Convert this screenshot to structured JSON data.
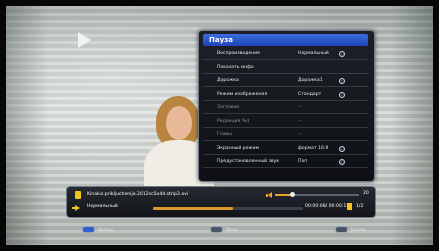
{
  "menu": {
    "title": "Пауза",
    "items": [
      {
        "label": "Воспроизведение",
        "value": "Нормальный",
        "has_option": true,
        "enabled": true
      },
      {
        "label": "Показать инфо",
        "value": "",
        "has_option": false,
        "enabled": true
      },
      {
        "label": "Дорожка",
        "value": "Дорожка1",
        "has_option": true,
        "enabled": true
      },
      {
        "label": "Режим изображения",
        "value": "Стандарт",
        "has_option": true,
        "enabled": true
      },
      {
        "label": "Заглавие",
        "value": "--",
        "has_option": false,
        "enabled": false
      },
      {
        "label": "Редакция %d",
        "value": "--",
        "has_option": false,
        "enabled": false
      },
      {
        "label": "Главы",
        "value": "--",
        "has_option": false,
        "enabled": false
      },
      {
        "label": "Экранный режим",
        "value": "формат 16:9",
        "has_option": true,
        "enabled": true
      },
      {
        "label": "Предустановленный звук",
        "value": "Поп",
        "has_option": true,
        "enabled": true
      }
    ]
  },
  "info_panel": {
    "file_name": "Kinakis.prikljuchenija.2012sc5o4d.strip3.avi",
    "volume_value": "20",
    "volume_level": 0.2,
    "playback_mode": "Нормальный",
    "time": "00:00:08/ 00:00:15",
    "progress": 0.53,
    "page": "1/2"
  },
  "footer": {
    "select_label": "Выбор",
    "enter_label": "Ввод",
    "back_label": "Назад"
  },
  "colors": {
    "accent_blue": "#2f5fd0",
    "accent_yellow": "#f2c417",
    "progress_orange": "#d89a2b"
  },
  "icons": [
    "play-icon",
    "file-icon",
    "speaker-icon",
    "arrow-right-icon",
    "page-icon",
    "option-icon"
  ]
}
